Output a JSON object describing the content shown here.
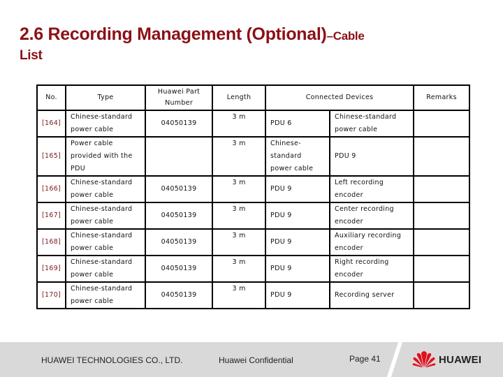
{
  "slide": {
    "title_main": "2.6 Recording Management (Optional)",
    "title_suffix": "–Cable",
    "title_line2": "List"
  },
  "table": {
    "headers": {
      "no": "No.",
      "type": "Type",
      "part_line1": "Huawei Part",
      "part_line2": "Number",
      "length": "Length",
      "connected": "Connected Devices",
      "remarks": "Remarks"
    },
    "rows": [
      {
        "no": "[164]",
        "type": "Chinese-standard power cable",
        "part": "04050139",
        "length": "3 m",
        "dev1": "PDU 6",
        "dev2": "Chinese-standard power cable",
        "remarks": ""
      },
      {
        "no": "[165]",
        "type": "Power cable provided with the PDU",
        "part": "",
        "length": "3 m",
        "dev1": "Chinese-standard power cable",
        "dev2": "PDU 9",
        "remarks": ""
      },
      {
        "no": "[166]",
        "type": "Chinese-standard power cable",
        "part": "04050139",
        "length": "3 m",
        "dev1": "PDU 9",
        "dev2": "Left recording encoder",
        "remarks": ""
      },
      {
        "no": "[167]",
        "type": "Chinese-standard power cable",
        "part": "04050139",
        "length": "3 m",
        "dev1": "PDU 9",
        "dev2": "Center recording encoder",
        "remarks": ""
      },
      {
        "no": "[168]",
        "type": "Chinese-standard power cable",
        "part": "04050139",
        "length": "3 m",
        "dev1": "PDU 9",
        "dev2": "Auxiliary recording encoder",
        "remarks": ""
      },
      {
        "no": "[169]",
        "type": "Chinese-standard power cable",
        "part": "04050139",
        "length": "3 m",
        "dev1": "PDU 9",
        "dev2": "Right recording encoder",
        "remarks": ""
      },
      {
        "no": "[170]",
        "type": "Chinese-standard power cable",
        "part": "04050139",
        "length": "3 m",
        "dev1": "PDU 9",
        "dev2": "Recording server",
        "remarks": ""
      }
    ]
  },
  "footer": {
    "company": "HUAWEI TECHNOLOGIES CO., LTD.",
    "confidential": "Huawei Confidential",
    "page": "Page 41",
    "logo_text": "HUAWEI",
    "logo_icon": "huawei-petal-logo"
  },
  "colors": {
    "title": "#8b1116",
    "logo_red": "#e0101d",
    "footer_bg": "#d9d9d9"
  }
}
